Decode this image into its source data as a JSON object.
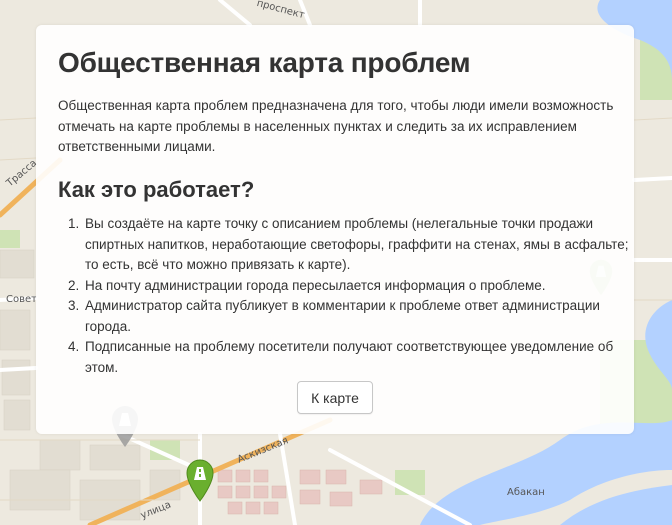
{
  "page": {
    "title": "Общественная карта проблем",
    "intro": "Общественная карта проблем предназначена для того, чтобы люди имели возможность отмечать на карте проблемы в населенных пунктах и следить за их исправлением ответственными лицами.",
    "how_title": "Как это работает?",
    "steps": [
      "Вы создаёте на карте точку с описанием проблемы (нелегальные точки продажи спиртных напитков, неработающие светофоры, граффити на стенах, ямы в асфальте; то есть, всё что можно привязать к карте).",
      "На почту администрации города пересылается информация о проблеме.",
      "Администратор сайта публикует в комментарии к проблеме ответ администрации города.",
      "Подписанные на проблему посетители получают соответствующее уведомление об этом."
    ],
    "to_map_button": "К карте"
  },
  "map": {
    "labels": {
      "prospect": "проспект",
      "sovet": "Совет",
      "askizskaya": "Аскизская",
      "abakan": "Абакан",
      "ulitsa": "улица",
      "trassa": "Трасса"
    },
    "colors": {
      "water": "#b3d1ff",
      "land": "#ede9df",
      "road_major": "#f0b35c",
      "pin_green": "#6aaf2e",
      "pin_gray": "#9a9a9a"
    },
    "icons": [
      "pin-green-road-icon",
      "pin-gray-icon",
      "pin-faded-icon"
    ]
  }
}
